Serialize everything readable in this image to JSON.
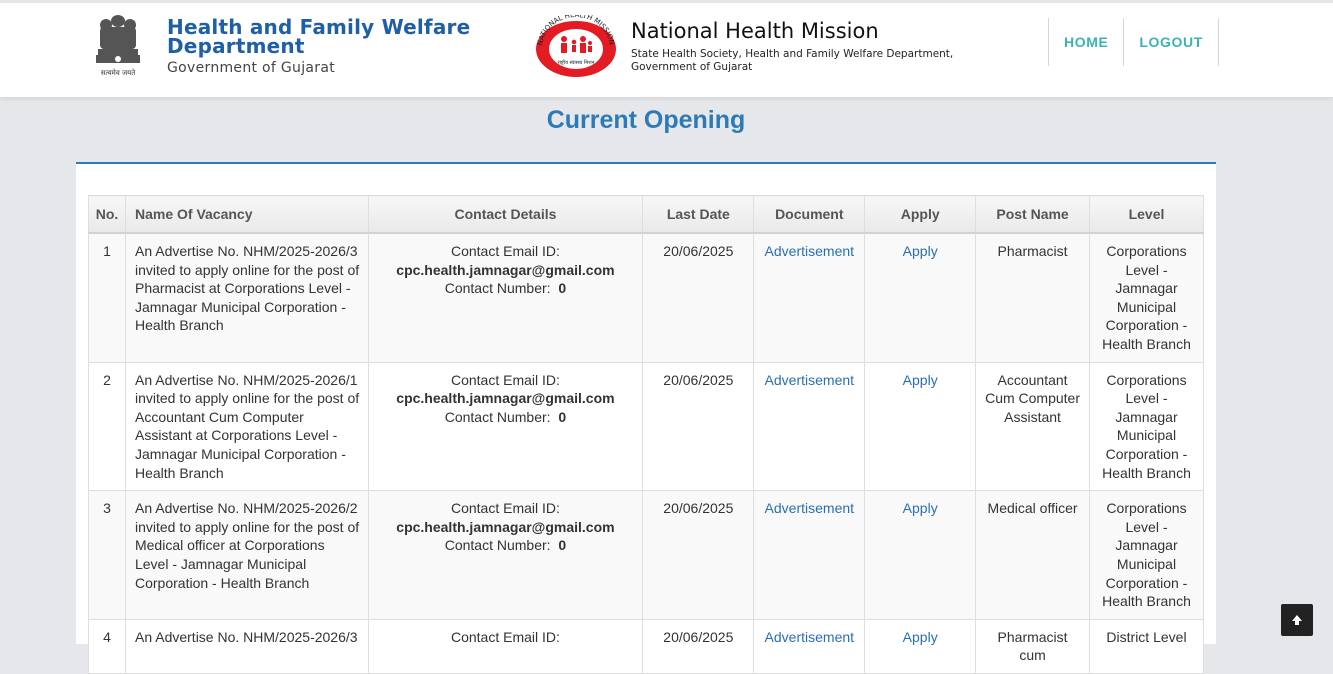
{
  "header": {
    "dept_line1": "Health and Family Welfare",
    "dept_line2": "Department",
    "dept_line3": "Government of Gujarat",
    "emblem_caption": "सत्यमेव जयते",
    "nhm_ring_text": "NATIONAL HEALTH MISSION",
    "nhm_logo_caption": "राष्ट्रीय स्वास्थ्य मिशन",
    "nhm_title": "National Health Mission",
    "nhm_sub1": "State Health Society, Health and Family Welfare Department,",
    "nhm_sub2": "Government of Gujarat"
  },
  "nav": {
    "home": "HOME",
    "logout": "LOGOUT"
  },
  "page_title": "Current Opening",
  "table": {
    "headers": [
      "No.",
      "Name Of Vacancy",
      "Contact Details",
      "Last Date",
      "Document",
      "Apply",
      "Post Name",
      "Level"
    ],
    "contact_label_email": "Contact Email ID:",
    "contact_label_number": "Contact Number:",
    "rows": [
      {
        "no": "1",
        "vacancy": "An Advertise No. NHM/2025-2026/3 invited to apply online for the post of Pharmacist at Corporations Level - Jamnagar Municipal Corporation - Health Branch",
        "email": "cpc.health.jamnagar@gmail.com",
        "number": "0",
        "last_date": "20/06/2025",
        "document": "Advertisement",
        "apply": "Apply",
        "post": "Pharmacist",
        "level": "Corporations Level - Jamnagar Municipal Corporation - Health Branch"
      },
      {
        "no": "2",
        "vacancy": "An Advertise No. NHM/2025-2026/1 invited to apply online for the post of Accountant Cum Computer Assistant at Corporations Level - Jamnagar Municipal Corporation -Health Branch",
        "email": "cpc.health.jamnagar@gmail.com",
        "number": "0",
        "last_date": "20/06/2025",
        "document": "Advertisement",
        "apply": "Apply",
        "post": "Accountant Cum Computer Assistant",
        "level": "Corporations Level - Jamnagar Municipal Corporation - Health Branch"
      },
      {
        "no": "3",
        "vacancy": "An Advertise No. NHM/2025-2026/2 invited to apply online for the post of Medical officer at Corporations Level - Jamnagar Municipal Corporation - Health Branch",
        "email": "cpc.health.jamnagar@gmail.com",
        "number": "0",
        "last_date": "20/06/2025",
        "document": "Advertisement",
        "apply": "Apply",
        "post": "Medical officer",
        "level": "Corporations Level - Jamnagar Municipal Corporation - Health Branch"
      },
      {
        "no": "4",
        "vacancy": "An Advertise No. NHM/2025-2026/3",
        "email": "",
        "number": "",
        "last_date": "20/06/2025",
        "document": "Advertisement",
        "apply": "Apply",
        "post": "Pharmacist cum",
        "level": "District Level"
      }
    ]
  },
  "colors": {
    "brand_blue": "#2d7ab8",
    "dept_blue": "#1f5fa6",
    "nav_teal": "#3bb3b3",
    "link_blue": "#2a6fb0",
    "nhm_red": "#e31b23"
  },
  "icons": {
    "scroll_top": "arrow-up-icon"
  }
}
